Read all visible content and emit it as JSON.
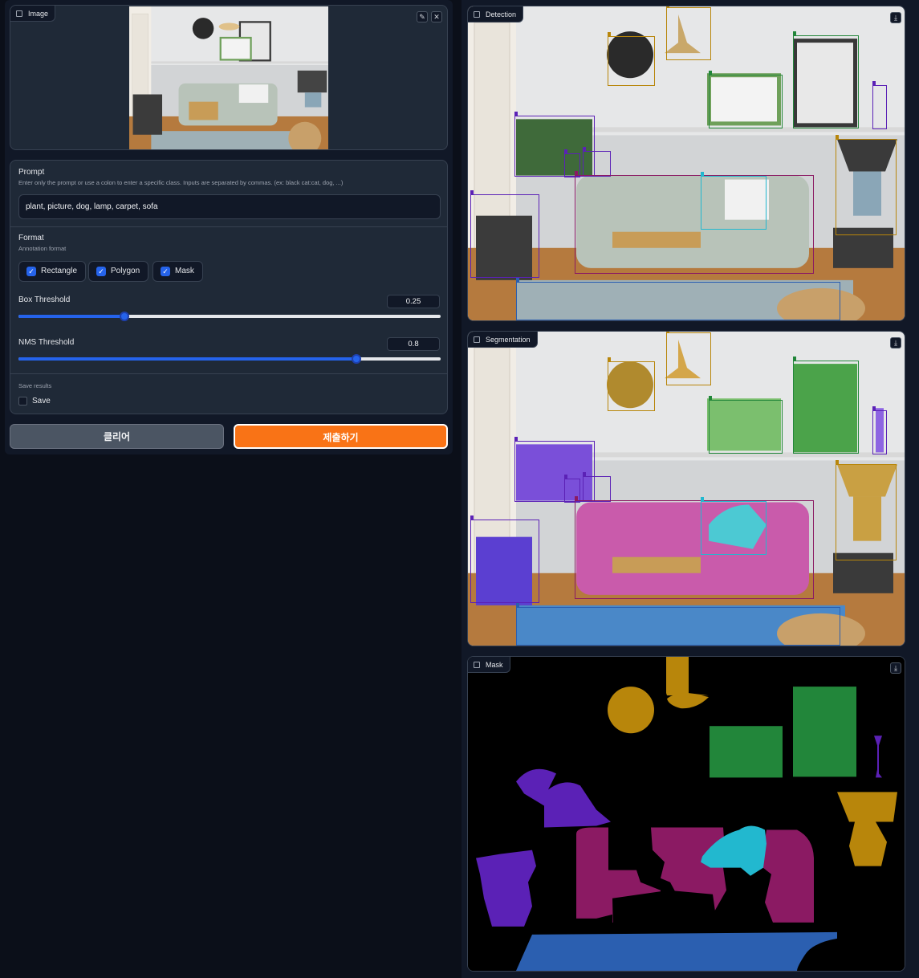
{
  "image_input": {
    "label": "Image",
    "edit_icon": "pencil-icon",
    "close_icon": "close-icon"
  },
  "prompt": {
    "title": "Prompt",
    "info": "Enter only the prompt or use a colon to enter a specific class. Inputs are separated by commas. (ex: black cat:cat, dog, ...)",
    "value": "plant, picture, dog, lamp, carpet, sofa"
  },
  "format": {
    "title": "Format",
    "info": "Annotation format",
    "options": [
      {
        "label": "Rectangle",
        "checked": true
      },
      {
        "label": "Polygon",
        "checked": true
      },
      {
        "label": "Mask",
        "checked": true
      }
    ]
  },
  "box_threshold": {
    "label": "Box Threshold",
    "value": "0.25",
    "fraction": 0.25
  },
  "nms_threshold": {
    "label": "NMS Threshold",
    "value": "0.8",
    "fraction": 0.8
  },
  "save": {
    "section_label": "Save results",
    "checkbox_label": "Save",
    "checked": false
  },
  "buttons": {
    "clear": "클리어",
    "submit": "제출하기"
  },
  "outputs": {
    "detection": {
      "label": "Detection",
      "download_icon": "download-icon"
    },
    "segmentation": {
      "label": "Segmentation",
      "download_icon": "download-icon"
    },
    "mask": {
      "label": "Mask",
      "download_icon": "download-icon"
    }
  },
  "colors": {
    "accent": "#2563eb",
    "submit": "#f97316",
    "plant": "#5b21b6",
    "picture": "#22863a",
    "lamp": "#b8860b",
    "dog": "#22b8cf",
    "sofa": "#8b1a63",
    "carpet": "#2b5fb0"
  }
}
